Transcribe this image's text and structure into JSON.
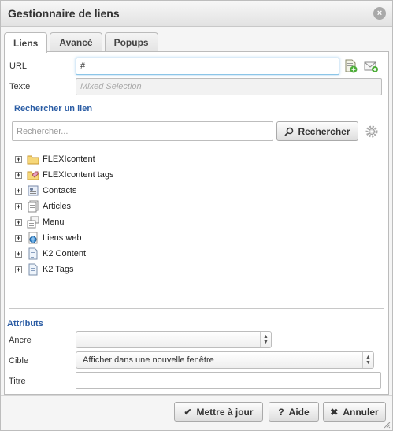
{
  "dialog": {
    "title": "Gestionnaire de liens",
    "close_glyph": "×"
  },
  "tabs": [
    {
      "label": "Liens",
      "active": true
    },
    {
      "label": "Avancé",
      "active": false
    },
    {
      "label": "Popups",
      "active": false
    }
  ],
  "link": {
    "url_label": "URL",
    "url_value": "#",
    "text_label": "Texte",
    "text_placeholder": "Mixed Selection"
  },
  "search": {
    "legend": "Rechercher un lien",
    "placeholder": "Rechercher...",
    "button_label": "Rechercher"
  },
  "tree": [
    {
      "label": "FLEXIcontent",
      "icon": "folder-icon"
    },
    {
      "label": "FLEXIcontent tags",
      "icon": "tag-folder-icon"
    },
    {
      "label": "Contacts",
      "icon": "contacts-icon"
    },
    {
      "label": "Articles",
      "icon": "articles-icon"
    },
    {
      "label": "Menu",
      "icon": "menu-icon"
    },
    {
      "label": "Liens web",
      "icon": "weblinks-icon"
    },
    {
      "label": "K2 Content",
      "icon": "document-icon"
    },
    {
      "label": "K2 Tags",
      "icon": "document-icon"
    }
  ],
  "attributes": {
    "title": "Attributs",
    "anchor_label": "Ancre",
    "anchor_value": "",
    "target_label": "Cible",
    "target_value": "Afficher dans une nouvelle fenêtre",
    "title_label": "Titre",
    "title_value": ""
  },
  "footer": {
    "update_label": "Mettre à jour",
    "help_label": "Aide",
    "cancel_label": "Annuler"
  },
  "colors": {
    "accent_blue": "#2a5ca4",
    "focus_border": "#8cc6e8"
  }
}
